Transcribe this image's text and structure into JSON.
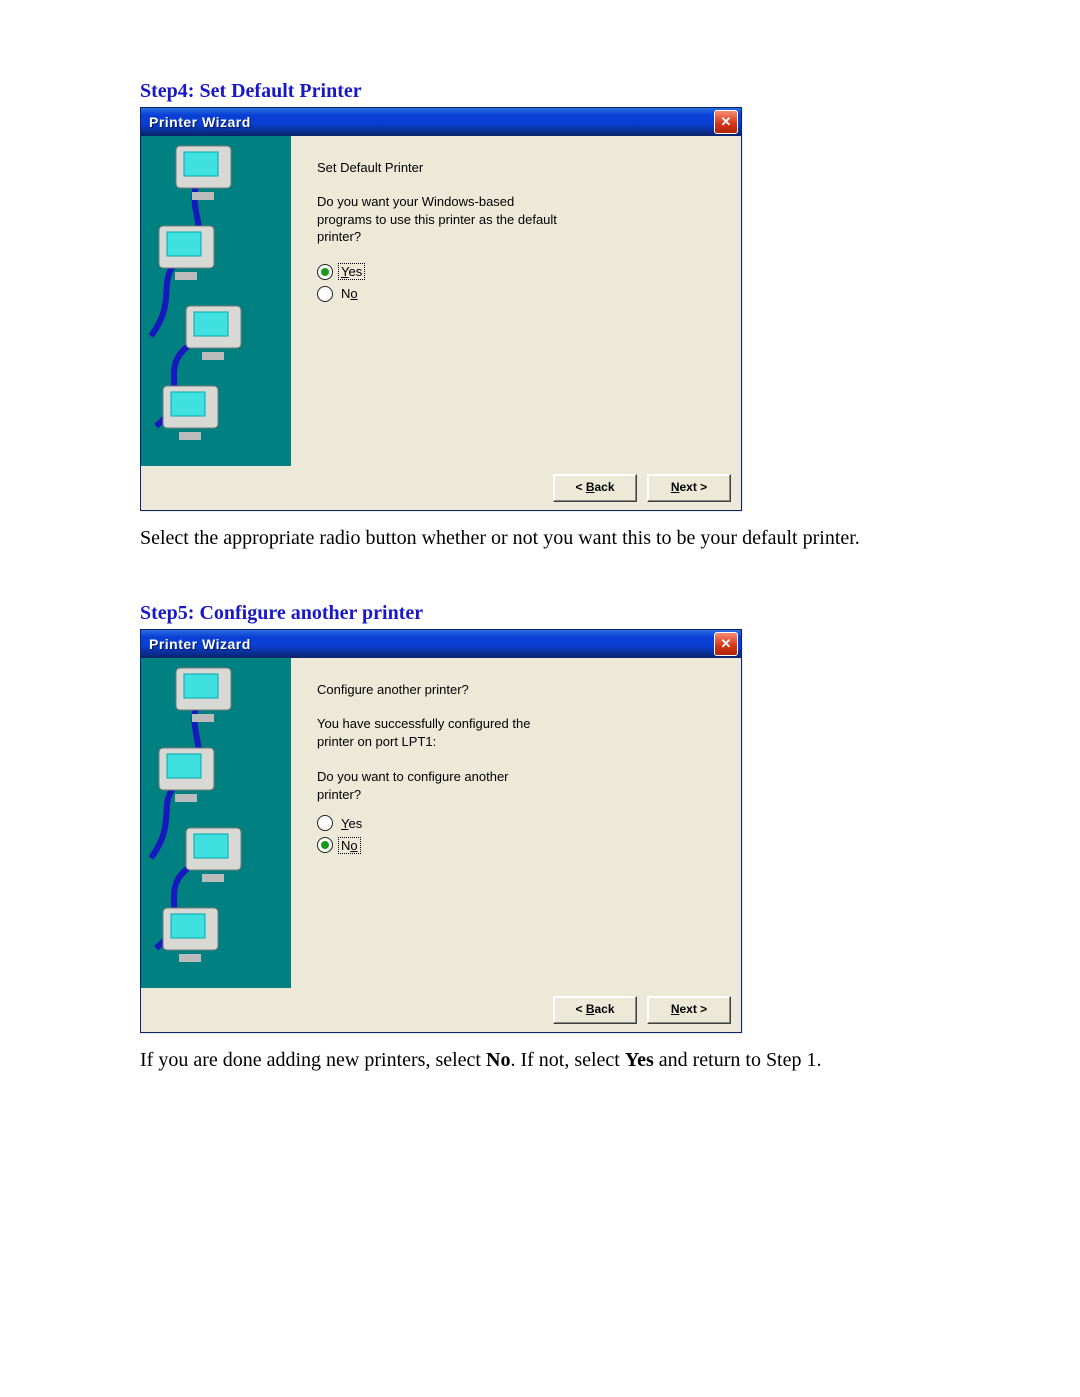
{
  "step4": {
    "heading": "Step4: Set Default Printer",
    "caption": "Select the appropriate radio button whether or not you want this to be your default printer.",
    "window": {
      "title": "Printer Wizard",
      "heading": "Set Default Printer",
      "body": "Do you want your Windows-based programs to use this printer as the default printer?",
      "radios": {
        "yes": {
          "label": "Yes",
          "underline": "Y",
          "rest": "es",
          "selected": true,
          "focused": true
        },
        "no": {
          "label": "No",
          "underline": "o",
          "before": "N",
          "selected": false,
          "focused": false
        }
      },
      "buttons": {
        "back": "< Back",
        "back_u": "B",
        "next": "Next >",
        "next_u": "N"
      }
    }
  },
  "step5": {
    "heading": "Step5: Configure another printer",
    "caption_plain": "If you are done adding new printers, select ",
    "caption_bold1": "No",
    "caption_mid": ".  If not, select ",
    "caption_bold2": "Yes",
    "caption_end": " and return to Step 1.",
    "window": {
      "title": "Printer Wizard",
      "heading": "Configure another printer?",
      "body1": "You have successfully configured the printer on port LPT1:",
      "body2": "Do you want to configure another printer?",
      "radios": {
        "yes": {
          "label": "Yes",
          "underline": "Y",
          "rest": "es",
          "selected": false,
          "focused": false
        },
        "no": {
          "label": "No",
          "underline": "o",
          "before": "N",
          "selected": true,
          "focused": true
        }
      },
      "buttons": {
        "back": "< Back",
        "back_u": "B",
        "next": "Next >",
        "next_u": "N"
      }
    }
  }
}
